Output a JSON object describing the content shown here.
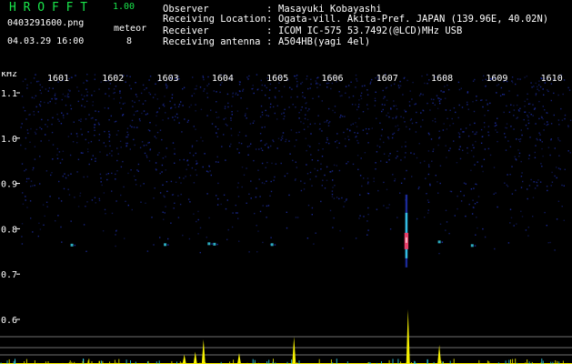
{
  "header": {
    "brand": "H R O F F T",
    "version": "1.00",
    "filename": "0403291600.png",
    "datetime": "04.03.29 16:00",
    "meteor_label": "meteor",
    "meteor_count": "8"
  },
  "station": {
    "rows": [
      {
        "label": "Observer",
        "sep": ":",
        "value": "Masayuki Kobayashi"
      },
      {
        "label": "Receiving Location",
        "sep": ":",
        "value": "Ogata-vill. Akita-Pref. JAPAN (139.96E, 40.02N)"
      },
      {
        "label": "Receiver",
        "sep": ":",
        "value": "ICOM IC-575 53.7492(@LCD)MHz USB"
      },
      {
        "label": "Receiving antenna",
        "sep": ":",
        "value": "A504HB(yagi 4el)"
      }
    ]
  },
  "colors": {
    "background": "#000000",
    "noise": "#1e2fa8",
    "grid_line": "#c9c9c9",
    "signal_hot": "#e8406a",
    "signal_cyan": "#37d7f0",
    "trace_yellow": "#f5f000",
    "brand_green": "#19e64b"
  },
  "chart_data": {
    "type": "heatmap",
    "y_unit": "kHz",
    "x_ticks": [
      "1601",
      "1602",
      "1603",
      "1604",
      "1605",
      "1606",
      "1607",
      "1608",
      "1609",
      "1610"
    ],
    "y_ticks": [
      "1.1",
      "1.0",
      "0.9",
      "0.8",
      "0.7",
      "0.6"
    ],
    "xlim": [
      1600.4,
      1610.5
    ],
    "ylim": [
      0.58,
      1.18
    ],
    "events": [
      {
        "x": 1601.25,
        "y": 0.765
      },
      {
        "x": 1602.95,
        "y": 0.766
      },
      {
        "x": 1603.75,
        "y": 0.768
      },
      {
        "x": 1603.85,
        "y": 0.767
      },
      {
        "x": 1604.9,
        "y": 0.766
      },
      {
        "x": 1607.35,
        "y": 0.775,
        "strong": true
      },
      {
        "x": 1607.95,
        "y": 0.772
      },
      {
        "x": 1608.55,
        "y": 0.764
      }
    ],
    "trace_peaks": [
      {
        "x": 1603.3,
        "h": 0.35
      },
      {
        "x": 1603.5,
        "h": 0.45
      },
      {
        "x": 1603.65,
        "h": 0.9
      },
      {
        "x": 1604.3,
        "h": 0.4
      },
      {
        "x": 1605.3,
        "h": 1.0
      },
      {
        "x": 1607.38,
        "h": 2.0
      },
      {
        "x": 1607.95,
        "h": 0.7
      }
    ]
  }
}
